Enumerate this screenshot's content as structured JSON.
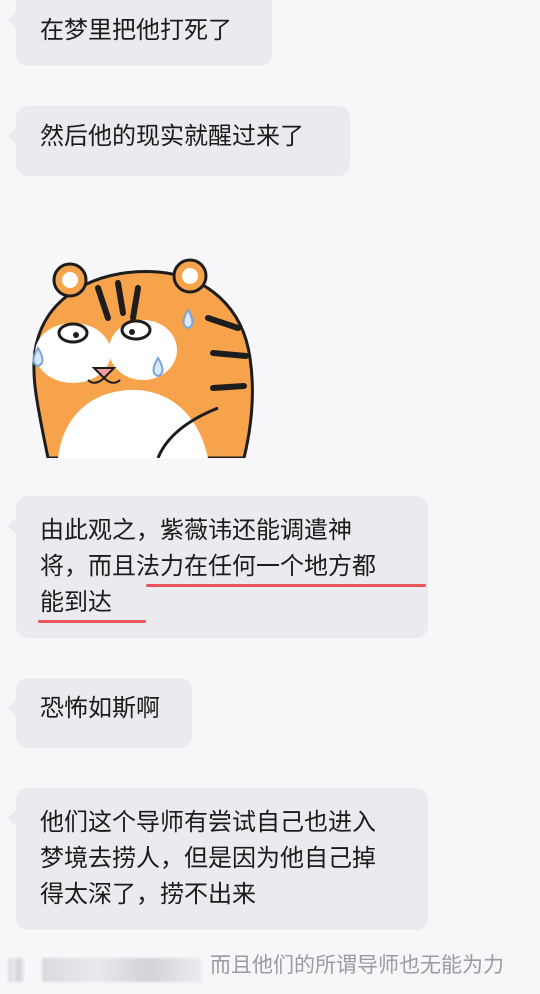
{
  "messages": [
    {
      "text": "在梦里把他打死了"
    },
    {
      "text": "然后他的现实就醒过来了"
    },
    {
      "line1": "由此观之，紫薇讳还能调遣神",
      "line2": "将，而且法力在任何一个地方都",
      "line3": "能到达"
    },
    {
      "text": "恐怖如斯啊"
    },
    {
      "line1": "他们这个导师有尝试自己也进入",
      "line2": "梦境去捞人，但是因为他自己掉",
      "line3": "得太深了，捞不出来"
    }
  ],
  "sticker": {
    "name": "tiger-sticker"
  },
  "bottom_preview": {
    "text": "而且他们的所谓导师也无能为力"
  },
  "colors": {
    "background": "#f7f7f9",
    "bubble": "#eaeaef",
    "underline": "#e8545c",
    "tiger_orange": "#f6a34b",
    "tiger_stripe": "#1d1d1d"
  }
}
